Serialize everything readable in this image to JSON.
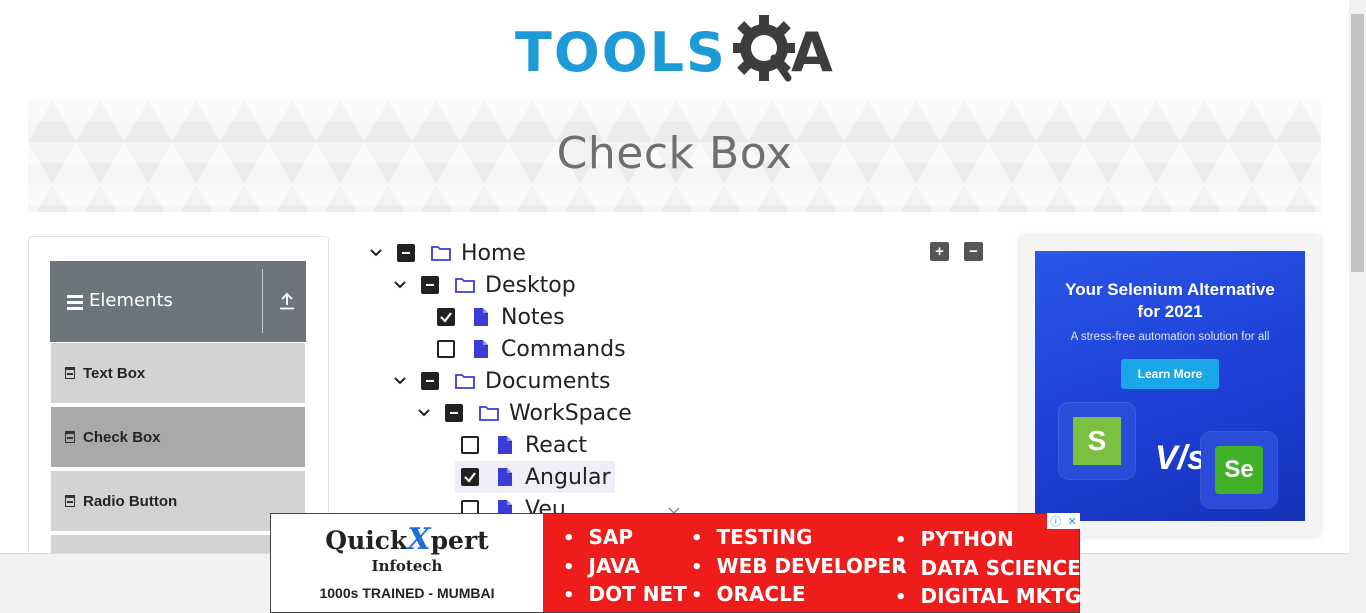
{
  "header": {
    "logo_text": "TOOLS",
    "logo_text_end": "A",
    "logo_icon": "gear-q-icon",
    "brand_colors": {
      "blue": "#1d9bd6",
      "dark": "#3d3d3d"
    }
  },
  "page": {
    "title": "Check Box"
  },
  "sidebar": {
    "group_title": "Elements",
    "group_icon": "hamburger-icon",
    "collapse_icon": "upload-arrow-icon",
    "items": [
      {
        "label": "Text Box",
        "active": false
      },
      {
        "label": "Check Box",
        "active": true
      },
      {
        "label": "Radio Button",
        "active": false
      }
    ]
  },
  "tree": {
    "expand_all_icon": "plus-square-icon",
    "collapse_all_icon": "minus-square-icon",
    "nodes": [
      {
        "label": "Home",
        "type": "folder",
        "state": "half",
        "expanded": true
      },
      {
        "label": "Desktop",
        "type": "folder",
        "state": "half",
        "expanded": true
      },
      {
        "label": "Notes",
        "type": "file",
        "state": "checked"
      },
      {
        "label": "Commands",
        "type": "file",
        "state": "unchecked"
      },
      {
        "label": "Documents",
        "type": "folder",
        "state": "half",
        "expanded": true
      },
      {
        "label": "WorkSpace",
        "type": "folder",
        "state": "half",
        "expanded": true
      },
      {
        "label": "React",
        "type": "file",
        "state": "unchecked"
      },
      {
        "label": "Angular",
        "type": "file",
        "state": "checked",
        "highlighted": true
      },
      {
        "label": "Veu",
        "type": "file",
        "state": "unchecked"
      }
    ]
  },
  "ad_right": {
    "headline_line1": "Your Selenium Alternative",
    "headline_line2": "for 2021",
    "subline": "A stress-free automation solution for all",
    "cta": "Learn More",
    "vs_text": "V/s",
    "left_tile_letter": "S",
    "right_tile_letter": "Se",
    "colors": {
      "bg": "#1d3fd6",
      "cta": "#19a7e8",
      "tile_green": "#7bc043"
    }
  },
  "ad_bottom": {
    "brand_quick": "Quick",
    "brand_x": "X",
    "brand_pert": "pert",
    "brand_infotech": "Infotech",
    "brand_tagline": "1000s TRAINED - MUMBAI",
    "col1": [
      "SAP",
      "JAVA",
      "DOT NET"
    ],
    "col2": [
      "TESTING",
      "WEB DEVELOPER",
      "ORACLE"
    ],
    "col3": [
      "PYTHON",
      "DATA SCIENCE",
      "DIGITAL MKTG."
    ],
    "bg_color": "#ef1c1c",
    "ad_info_icon": "info-icon",
    "ad_close_icon": "close-icon"
  }
}
